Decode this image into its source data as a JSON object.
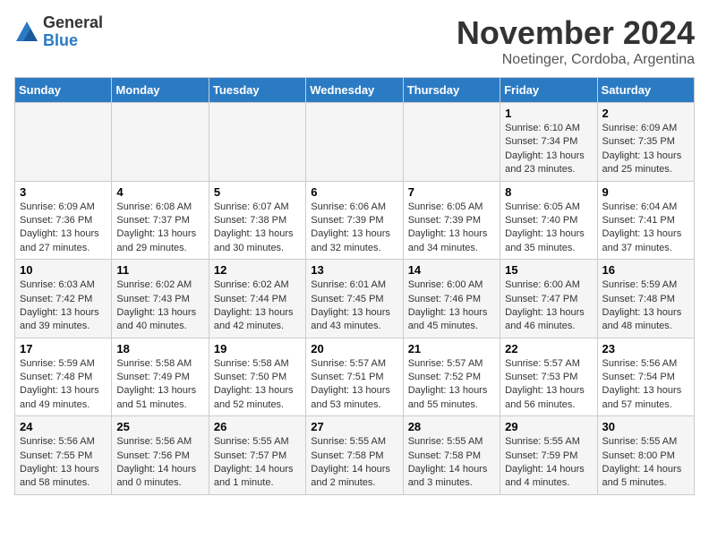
{
  "header": {
    "logo_line1": "General",
    "logo_line2": "Blue",
    "month": "November 2024",
    "location": "Noetinger, Cordoba, Argentina"
  },
  "weekdays": [
    "Sunday",
    "Monday",
    "Tuesday",
    "Wednesday",
    "Thursday",
    "Friday",
    "Saturday"
  ],
  "weeks": [
    [
      {
        "day": "",
        "info": ""
      },
      {
        "day": "",
        "info": ""
      },
      {
        "day": "",
        "info": ""
      },
      {
        "day": "",
        "info": ""
      },
      {
        "day": "",
        "info": ""
      },
      {
        "day": "1",
        "info": "Sunrise: 6:10 AM\nSunset: 7:34 PM\nDaylight: 13 hours\nand 23 minutes."
      },
      {
        "day": "2",
        "info": "Sunrise: 6:09 AM\nSunset: 7:35 PM\nDaylight: 13 hours\nand 25 minutes."
      }
    ],
    [
      {
        "day": "3",
        "info": "Sunrise: 6:09 AM\nSunset: 7:36 PM\nDaylight: 13 hours\nand 27 minutes."
      },
      {
        "day": "4",
        "info": "Sunrise: 6:08 AM\nSunset: 7:37 PM\nDaylight: 13 hours\nand 29 minutes."
      },
      {
        "day": "5",
        "info": "Sunrise: 6:07 AM\nSunset: 7:38 PM\nDaylight: 13 hours\nand 30 minutes."
      },
      {
        "day": "6",
        "info": "Sunrise: 6:06 AM\nSunset: 7:39 PM\nDaylight: 13 hours\nand 32 minutes."
      },
      {
        "day": "7",
        "info": "Sunrise: 6:05 AM\nSunset: 7:39 PM\nDaylight: 13 hours\nand 34 minutes."
      },
      {
        "day": "8",
        "info": "Sunrise: 6:05 AM\nSunset: 7:40 PM\nDaylight: 13 hours\nand 35 minutes."
      },
      {
        "day": "9",
        "info": "Sunrise: 6:04 AM\nSunset: 7:41 PM\nDaylight: 13 hours\nand 37 minutes."
      }
    ],
    [
      {
        "day": "10",
        "info": "Sunrise: 6:03 AM\nSunset: 7:42 PM\nDaylight: 13 hours\nand 39 minutes."
      },
      {
        "day": "11",
        "info": "Sunrise: 6:02 AM\nSunset: 7:43 PM\nDaylight: 13 hours\nand 40 minutes."
      },
      {
        "day": "12",
        "info": "Sunrise: 6:02 AM\nSunset: 7:44 PM\nDaylight: 13 hours\nand 42 minutes."
      },
      {
        "day": "13",
        "info": "Sunrise: 6:01 AM\nSunset: 7:45 PM\nDaylight: 13 hours\nand 43 minutes."
      },
      {
        "day": "14",
        "info": "Sunrise: 6:00 AM\nSunset: 7:46 PM\nDaylight: 13 hours\nand 45 minutes."
      },
      {
        "day": "15",
        "info": "Sunrise: 6:00 AM\nSunset: 7:47 PM\nDaylight: 13 hours\nand 46 minutes."
      },
      {
        "day": "16",
        "info": "Sunrise: 5:59 AM\nSunset: 7:48 PM\nDaylight: 13 hours\nand 48 minutes."
      }
    ],
    [
      {
        "day": "17",
        "info": "Sunrise: 5:59 AM\nSunset: 7:48 PM\nDaylight: 13 hours\nand 49 minutes."
      },
      {
        "day": "18",
        "info": "Sunrise: 5:58 AM\nSunset: 7:49 PM\nDaylight: 13 hours\nand 51 minutes."
      },
      {
        "day": "19",
        "info": "Sunrise: 5:58 AM\nSunset: 7:50 PM\nDaylight: 13 hours\nand 52 minutes."
      },
      {
        "day": "20",
        "info": "Sunrise: 5:57 AM\nSunset: 7:51 PM\nDaylight: 13 hours\nand 53 minutes."
      },
      {
        "day": "21",
        "info": "Sunrise: 5:57 AM\nSunset: 7:52 PM\nDaylight: 13 hours\nand 55 minutes."
      },
      {
        "day": "22",
        "info": "Sunrise: 5:57 AM\nSunset: 7:53 PM\nDaylight: 13 hours\nand 56 minutes."
      },
      {
        "day": "23",
        "info": "Sunrise: 5:56 AM\nSunset: 7:54 PM\nDaylight: 13 hours\nand 57 minutes."
      }
    ],
    [
      {
        "day": "24",
        "info": "Sunrise: 5:56 AM\nSunset: 7:55 PM\nDaylight: 13 hours\nand 58 minutes."
      },
      {
        "day": "25",
        "info": "Sunrise: 5:56 AM\nSunset: 7:56 PM\nDaylight: 14 hours\nand 0 minutes."
      },
      {
        "day": "26",
        "info": "Sunrise: 5:55 AM\nSunset: 7:57 PM\nDaylight: 14 hours\nand 1 minute."
      },
      {
        "day": "27",
        "info": "Sunrise: 5:55 AM\nSunset: 7:58 PM\nDaylight: 14 hours\nand 2 minutes."
      },
      {
        "day": "28",
        "info": "Sunrise: 5:55 AM\nSunset: 7:58 PM\nDaylight: 14 hours\nand 3 minutes."
      },
      {
        "day": "29",
        "info": "Sunrise: 5:55 AM\nSunset: 7:59 PM\nDaylight: 14 hours\nand 4 minutes."
      },
      {
        "day": "30",
        "info": "Sunrise: 5:55 AM\nSunset: 8:00 PM\nDaylight: 14 hours\nand 5 minutes."
      }
    ]
  ]
}
